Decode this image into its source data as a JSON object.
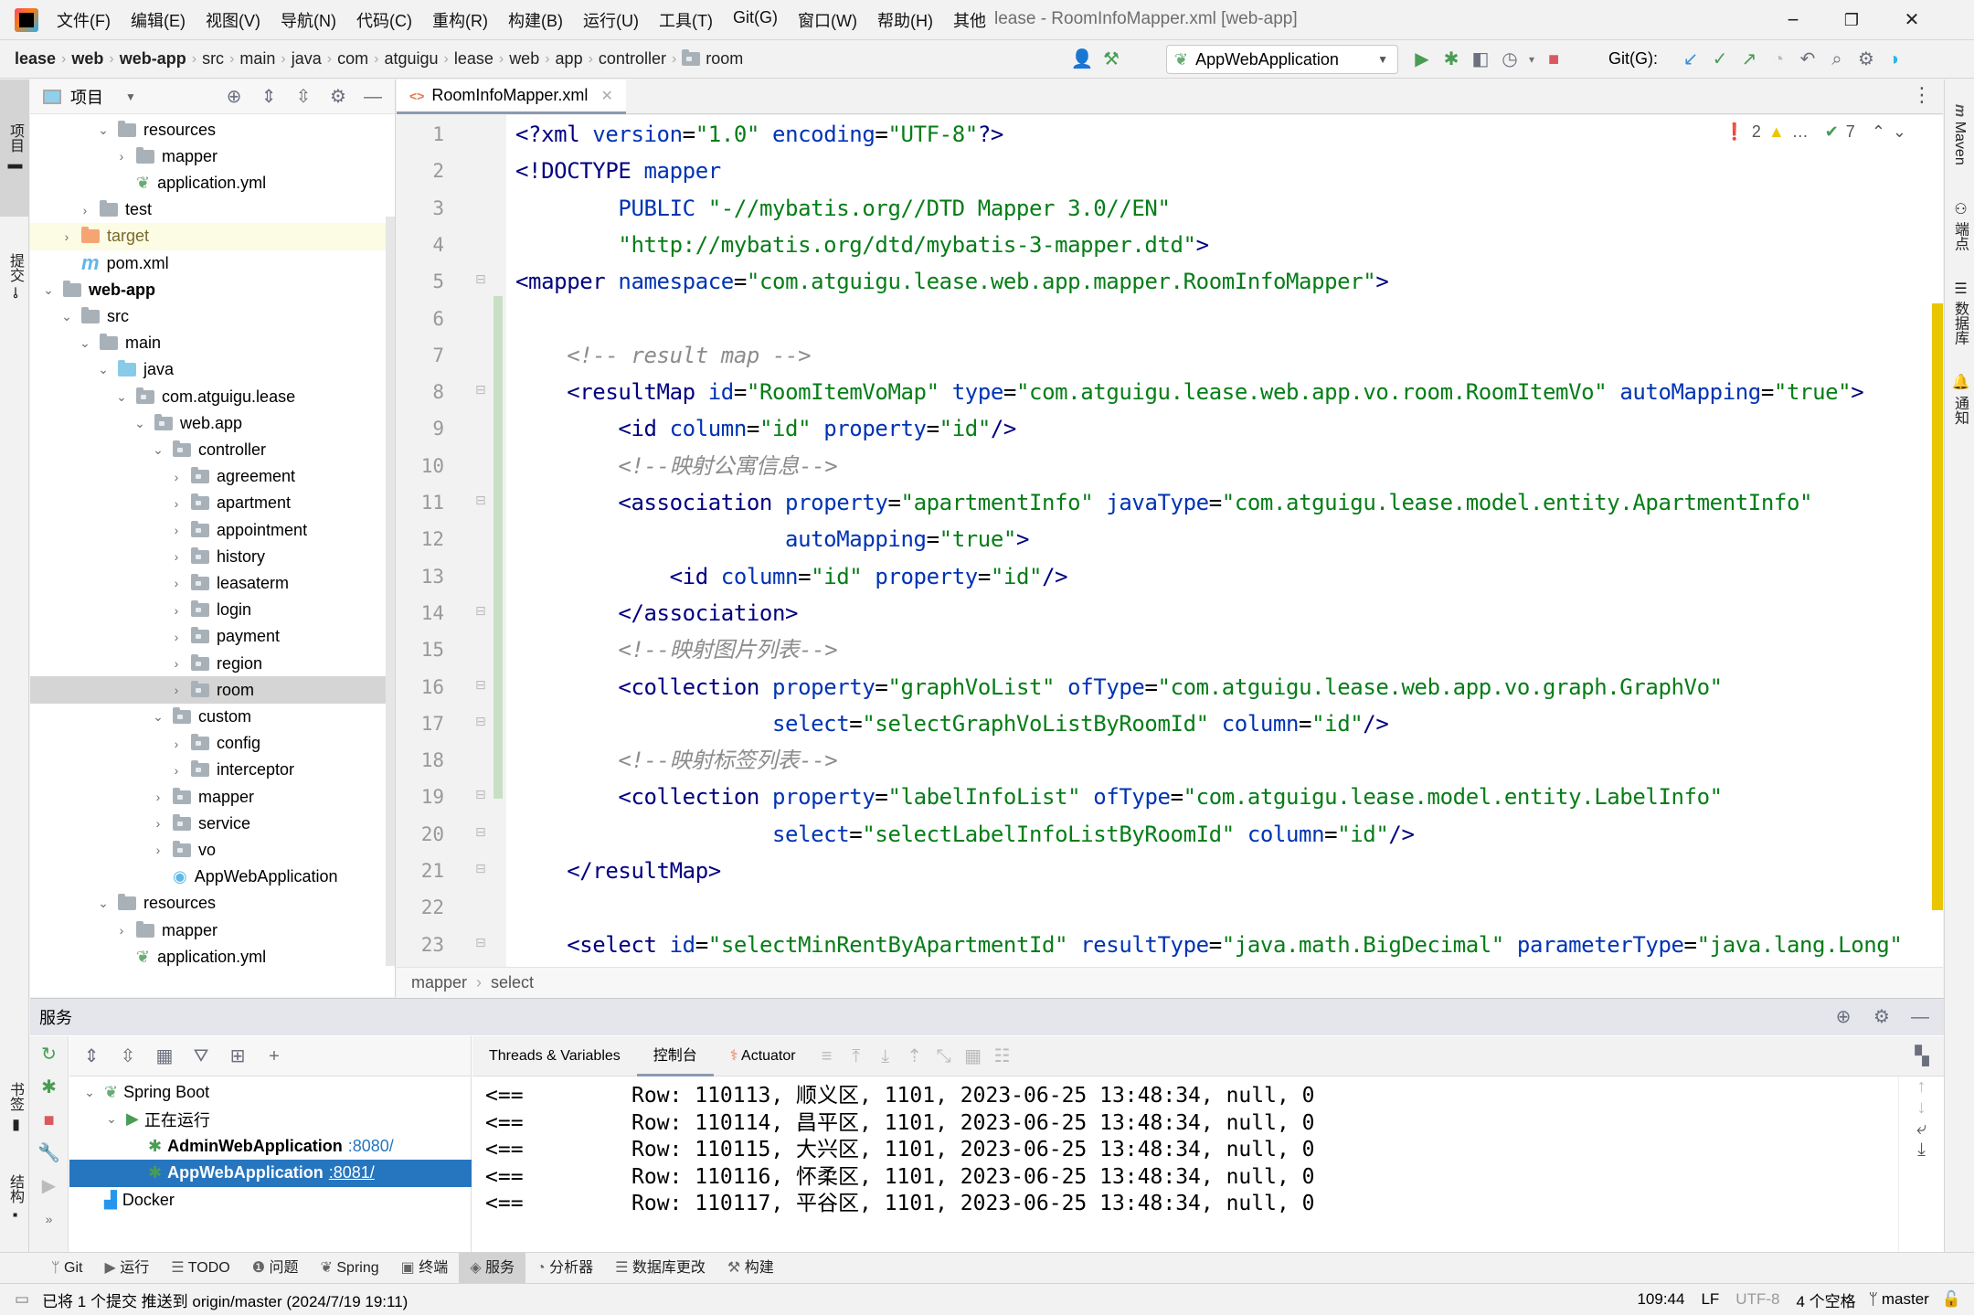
{
  "menu": [
    "文件(F)",
    "编辑(E)",
    "视图(V)",
    "导航(N)",
    "代码(C)",
    "重构(R)",
    "构建(B)",
    "运行(U)",
    "工具(T)",
    "Git(G)",
    "窗口(W)",
    "帮助(H)",
    "其他"
  ],
  "window_title": "lease - RoomInfoMapper.xml [web-app]",
  "window_controls": {
    "minimize": "−",
    "restore": "❐",
    "close": "✕"
  },
  "breadcrumb": [
    {
      "label": "lease",
      "bold": true
    },
    {
      "label": "web",
      "bold": true
    },
    {
      "label": "web-app",
      "bold": true
    },
    {
      "label": "src"
    },
    {
      "label": "main"
    },
    {
      "label": "java"
    },
    {
      "label": "com"
    },
    {
      "label": "atguigu"
    },
    {
      "label": "lease"
    },
    {
      "label": "web"
    },
    {
      "label": "app"
    },
    {
      "label": "controller"
    },
    {
      "label": "room",
      "icon": "package-folder"
    }
  ],
  "toolbar": {
    "run_config": "AppWebApplication",
    "git_label": "Git(G):"
  },
  "left_strip": {
    "project": "项目",
    "commit": "提交",
    "bookmarks": "书签",
    "structure": "结构"
  },
  "right_strip": {
    "maven": "Maven",
    "endpoints": "端点",
    "database": "数据库",
    "notifications": "通知"
  },
  "project_panel": {
    "title": "项目",
    "tree": [
      {
        "label": "resources",
        "depth": 5,
        "chev": "down",
        "icon": "resources"
      },
      {
        "label": "mapper",
        "depth": 6,
        "chev": "right",
        "icon": "folder"
      },
      {
        "label": "application.yml",
        "depth": 6,
        "chev": "",
        "icon": "spring"
      },
      {
        "label": "test",
        "depth": 4,
        "chev": "right",
        "icon": "folder"
      },
      {
        "label": "target",
        "depth": 3,
        "chev": "right",
        "icon": "orange",
        "highlight": true
      },
      {
        "label": "pom.xml",
        "depth": 3,
        "chev": "",
        "icon": "maven"
      },
      {
        "label": "web-app",
        "depth": 2,
        "chev": "down",
        "icon": "module",
        "bold": true
      },
      {
        "label": "src",
        "depth": 3,
        "chev": "down",
        "icon": "folder"
      },
      {
        "label": "main",
        "depth": 4,
        "chev": "down",
        "icon": "folder"
      },
      {
        "label": "java",
        "depth": 5,
        "chev": "down",
        "icon": "blue"
      },
      {
        "label": "com.atguigu.lease",
        "depth": 6,
        "chev": "down",
        "icon": "pkg"
      },
      {
        "label": "web.app",
        "depth": 7,
        "chev": "down",
        "icon": "pkg"
      },
      {
        "label": "controller",
        "depth": 8,
        "chev": "down",
        "icon": "pkg"
      },
      {
        "label": "agreement",
        "depth": 9,
        "chev": "right",
        "icon": "pkg"
      },
      {
        "label": "apartment",
        "depth": 9,
        "chev": "right",
        "icon": "pkg"
      },
      {
        "label": "appointment",
        "depth": 9,
        "chev": "right",
        "icon": "pkg"
      },
      {
        "label": "history",
        "depth": 9,
        "chev": "right",
        "icon": "pkg"
      },
      {
        "label": "leasaterm",
        "depth": 9,
        "chev": "right",
        "icon": "pkg"
      },
      {
        "label": "login",
        "depth": 9,
        "chev": "right",
        "icon": "pkg"
      },
      {
        "label": "payment",
        "depth": 9,
        "chev": "right",
        "icon": "pkg"
      },
      {
        "label": "region",
        "depth": 9,
        "chev": "right",
        "icon": "pkg"
      },
      {
        "label": "room",
        "depth": 9,
        "chev": "right",
        "icon": "pkg",
        "selected": true
      },
      {
        "label": "custom",
        "depth": 8,
        "chev": "down",
        "icon": "pkg"
      },
      {
        "label": "config",
        "depth": 9,
        "chev": "right",
        "icon": "pkg"
      },
      {
        "label": "interceptor",
        "depth": 9,
        "chev": "right",
        "icon": "pkg"
      },
      {
        "label": "mapper",
        "depth": 8,
        "chev": "right",
        "icon": "pkg"
      },
      {
        "label": "service",
        "depth": 8,
        "chev": "right",
        "icon": "pkg"
      },
      {
        "label": "vo",
        "depth": 8,
        "chev": "right",
        "icon": "pkg"
      },
      {
        "label": "AppWebApplication",
        "depth": 8,
        "chev": "",
        "icon": "springclass"
      },
      {
        "label": "resources",
        "depth": 5,
        "chev": "down",
        "icon": "resources"
      },
      {
        "label": "mapper",
        "depth": 6,
        "chev": "right",
        "icon": "folder"
      },
      {
        "label": "application.yml",
        "depth": 6,
        "chev": "",
        "icon": "spring"
      }
    ]
  },
  "editor": {
    "tab": "RoomInfoMapper.xml",
    "inspections": {
      "errors": "2",
      "warnings": "…",
      "typos": "7"
    },
    "lines": [
      [
        [
          "t",
          "<?xml "
        ],
        [
          "a",
          "version"
        ],
        [
          "p",
          "="
        ],
        [
          "s",
          "\"1.0\" "
        ],
        [
          "a",
          "encoding"
        ],
        [
          "p",
          "="
        ],
        [
          "s",
          "\"UTF-8\""
        ],
        [
          "t",
          "?>"
        ]
      ],
      [
        [
          "t",
          "<!DOCTYPE "
        ],
        [
          "a",
          "mapper"
        ]
      ],
      [
        [
          "a",
          "        PUBLIC "
        ],
        [
          "s",
          "\"-//mybatis.org//DTD Mapper 3.0//EN\""
        ]
      ],
      [
        [
          "s",
          "        \"http://mybatis.org/dtd/mybatis-3-mapper.dtd\""
        ],
        [
          "t",
          ">"
        ]
      ],
      [
        [
          "t",
          "<mapper "
        ],
        [
          "a",
          "namespace"
        ],
        [
          "p",
          "="
        ],
        [
          "s",
          "\"com.atguigu.lease.web.app.mapper.RoomInfoMapper\""
        ],
        [
          "t",
          ">"
        ]
      ],
      [],
      [
        [
          "c",
          "    <!-- result map -->"
        ]
      ],
      [
        [
          "t",
          "    <resultMap "
        ],
        [
          "a",
          "id"
        ],
        [
          "p",
          "="
        ],
        [
          "s",
          "\"RoomItemVoMap\" "
        ],
        [
          "a",
          "type"
        ],
        [
          "p",
          "="
        ],
        [
          "s",
          "\"com.atguigu.lease.web.app.vo.room.RoomItemVo\" "
        ],
        [
          "a",
          "autoMapping"
        ],
        [
          "p",
          "="
        ],
        [
          "s",
          "\"true\""
        ],
        [
          "t",
          ">"
        ]
      ],
      [
        [
          "t",
          "        <id "
        ],
        [
          "a",
          "column"
        ],
        [
          "p",
          "="
        ],
        [
          "s",
          "\"id\" "
        ],
        [
          "a",
          "property"
        ],
        [
          "p",
          "="
        ],
        [
          "s",
          "\"id\""
        ],
        [
          "t",
          "/>"
        ]
      ],
      [
        [
          "c",
          "        <!--映射公寓信息-->"
        ]
      ],
      [
        [
          "t",
          "        <association "
        ],
        [
          "a",
          "property"
        ],
        [
          "p",
          "="
        ],
        [
          "s",
          "\"apartmentInfo\" "
        ],
        [
          "a",
          "javaType"
        ],
        [
          "p",
          "="
        ],
        [
          "s",
          "\"com.atguigu.lease.model.entity.ApartmentInfo\""
        ]
      ],
      [
        [
          "a",
          "                     autoMapping"
        ],
        [
          "p",
          "="
        ],
        [
          "s",
          "\"true\""
        ],
        [
          "t",
          ">"
        ]
      ],
      [
        [
          "t",
          "            <id "
        ],
        [
          "a",
          "column"
        ],
        [
          "p",
          "="
        ],
        [
          "s",
          "\"id\" "
        ],
        [
          "a",
          "property"
        ],
        [
          "p",
          "="
        ],
        [
          "s",
          "\"id\""
        ],
        [
          "t",
          "/>"
        ]
      ],
      [
        [
          "t",
          "        </association>"
        ]
      ],
      [
        [
          "c",
          "        <!--映射图片列表-->"
        ]
      ],
      [
        [
          "t",
          "        <collection "
        ],
        [
          "a",
          "property"
        ],
        [
          "p",
          "="
        ],
        [
          "s",
          "\"graphVoList\" "
        ],
        [
          "a",
          "ofType"
        ],
        [
          "p",
          "="
        ],
        [
          "s",
          "\"com.atguigu.lease.web.app.vo.graph.GraphVo\""
        ]
      ],
      [
        [
          "a",
          "                    select"
        ],
        [
          "p",
          "="
        ],
        [
          "s",
          "\"selectGraphVoListByRoomId\" "
        ],
        [
          "a",
          "column"
        ],
        [
          "p",
          "="
        ],
        [
          "s",
          "\"id\""
        ],
        [
          "t",
          "/>"
        ]
      ],
      [
        [
          "c",
          "        <!--映射标签列表-->"
        ]
      ],
      [
        [
          "t",
          "        <collection "
        ],
        [
          "a",
          "property"
        ],
        [
          "p",
          "="
        ],
        [
          "s",
          "\"labelInfoList\" "
        ],
        [
          "a",
          "ofType"
        ],
        [
          "p",
          "="
        ],
        [
          "s",
          "\"com.atguigu.lease.model.entity.LabelInfo\""
        ]
      ],
      [
        [
          "a",
          "                    select"
        ],
        [
          "p",
          "="
        ],
        [
          "s",
          "\"selectLabelInfoListByRoomId\" "
        ],
        [
          "a",
          "column"
        ],
        [
          "p",
          "="
        ],
        [
          "s",
          "\"id\""
        ],
        [
          "t",
          "/>"
        ]
      ],
      [
        [
          "t",
          "    </resultMap>"
        ]
      ],
      [],
      [
        [
          "t",
          "    <select "
        ],
        [
          "a",
          "id"
        ],
        [
          "p",
          "="
        ],
        [
          "s",
          "\"selectMinRentByApartmentId\" "
        ],
        [
          "a",
          "resultType"
        ],
        [
          "p",
          "="
        ],
        [
          "s",
          "\"java.math.BigDecimal\" "
        ],
        [
          "a",
          "parameterType"
        ],
        [
          "p",
          "="
        ],
        [
          "s",
          "\"java.lang.Long\""
        ]
      ]
    ],
    "breadcrumb": [
      "mapper",
      "select"
    ]
  },
  "services": {
    "title": "服务",
    "tree": [
      {
        "label": "Spring Boot",
        "depth": 0,
        "chev": "down",
        "icon": "spring"
      },
      {
        "label": "正在运行",
        "depth": 1,
        "chev": "down",
        "icon": "run"
      },
      {
        "label": "AdminWebApplication",
        "port": ":8080/",
        "depth": 2,
        "icon": "bug"
      },
      {
        "label": "AppWebApplication",
        "port": ":8081/",
        "depth": 2,
        "icon": "bug",
        "selected": true
      },
      {
        "label": "Docker",
        "depth": 0,
        "icon": "docker"
      }
    ],
    "console_tabs": [
      "Threads & Variables",
      "控制台",
      "Actuator"
    ],
    "active_console_tab": 1,
    "console_lines": [
      {
        "prefix": "<==",
        "text": "Row: 110113, 顺义区, 1101, 2023-06-25 13:48:34, null, 0"
      },
      {
        "prefix": "<==",
        "text": "Row: 110114, 昌平区, 1101, 2023-06-25 13:48:34, null, 0"
      },
      {
        "prefix": "<==",
        "text": "Row: 110115, 大兴区, 1101, 2023-06-25 13:48:34, null, 0"
      },
      {
        "prefix": "<==",
        "text": "Row: 110116, 怀柔区, 1101, 2023-06-25 13:48:34, null, 0"
      },
      {
        "prefix": "<==",
        "text": "Row: 110117, 平谷区, 1101, 2023-06-25 13:48:34, null, 0"
      }
    ]
  },
  "toolwindow_bar": [
    {
      "label": "Git",
      "icon": "git"
    },
    {
      "label": "运行",
      "icon": "run"
    },
    {
      "label": "TODO",
      "icon": "list"
    },
    {
      "label": "问题",
      "icon": "problems"
    },
    {
      "label": "Spring",
      "icon": "spring"
    },
    {
      "label": "终端",
      "icon": "terminal"
    },
    {
      "label": "服务",
      "icon": "services",
      "active": true
    },
    {
      "label": "分析器",
      "icon": "profiler"
    },
    {
      "label": "数据库更改",
      "icon": "db"
    },
    {
      "label": "构建",
      "icon": "build"
    }
  ],
  "status_bar": {
    "message": "已将 1 个提交 推送到 origin/master (2024/7/19 19:11)",
    "position": "109:44",
    "line_sep": "LF",
    "encoding": "UTF-8",
    "indent": "4 个空格",
    "branch": "master"
  },
  "colors": {
    "accent": "#2675bf",
    "error": "#db5860",
    "warning_stripe": "#eac600",
    "run_green": "#499c54"
  }
}
